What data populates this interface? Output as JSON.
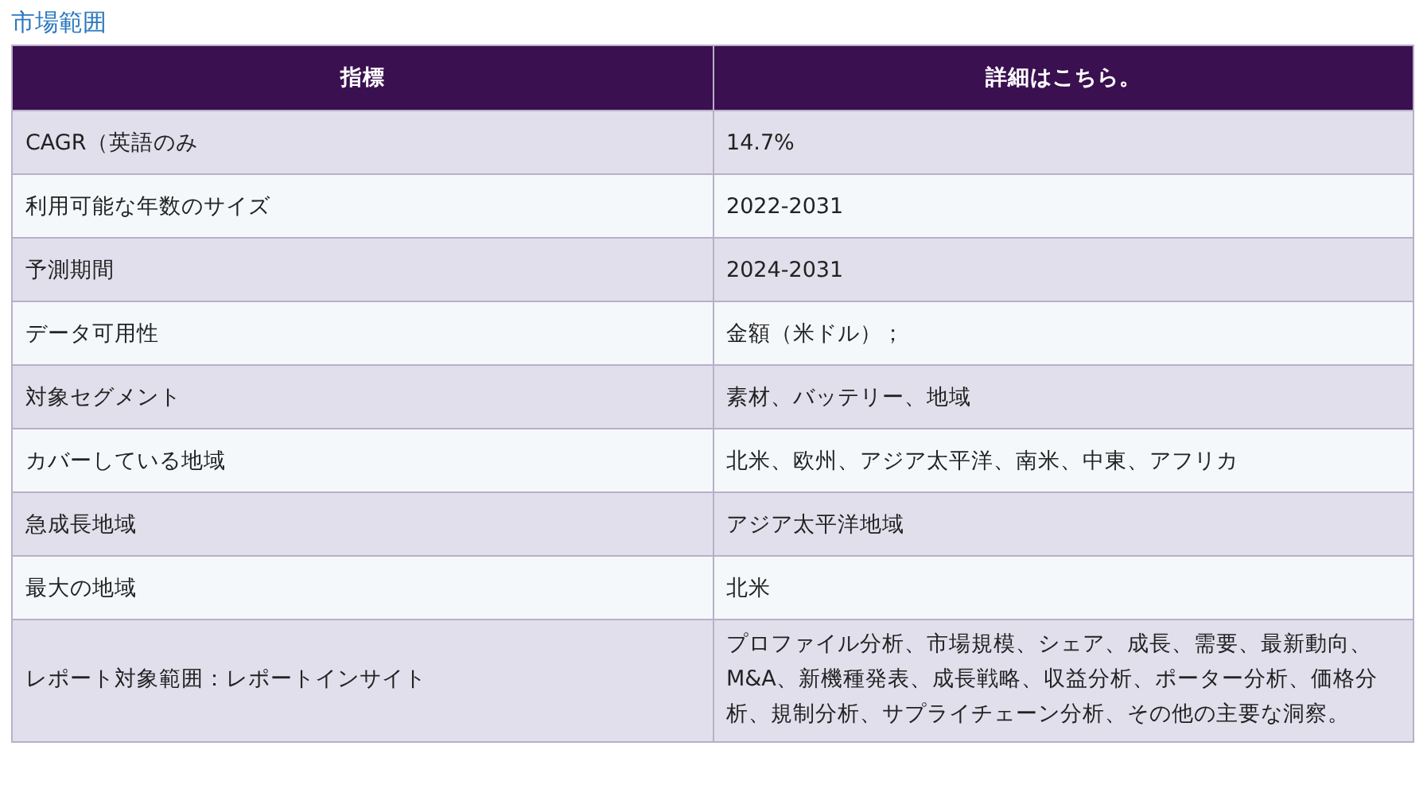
{
  "title": "市場範囲",
  "table": {
    "columns": [
      "指標",
      "詳細はこちら。"
    ],
    "rows": [
      {
        "cells": [
          "CAGR（英語のみ",
          "14.7%"
        ]
      },
      {
        "cells": [
          "利用可能な年数のサイズ",
          "2022-2031"
        ]
      },
      {
        "cells": [
          "予測期間",
          "2024-2031"
        ]
      },
      {
        "cells": [
          "データ可用性",
          "金額（米ドル）；"
        ]
      },
      {
        "cells": [
          "対象セグメント",
          "素材、バッテリー、地域"
        ]
      },
      {
        "cells": [
          "カバーしている地域",
          "北米、欧州、アジア太平洋、南米、中東、アフリカ"
        ]
      },
      {
        "cells": [
          "急成長地域",
          "アジア太平洋地域"
        ]
      },
      {
        "cells": [
          "最大の地域",
          "北米"
        ]
      },
      {
        "cells": [
          "レポート対象範囲：レポートインサイト",
          "プロファイル分析、市場規模、シェア、成長、需要、最新動向、M&A、新機種発表、成長戦略、収益分析、ポーター分析、価格分析、規制分析、サプライチェーン分析、その他の主要な洞察。"
        ]
      }
    ]
  }
}
